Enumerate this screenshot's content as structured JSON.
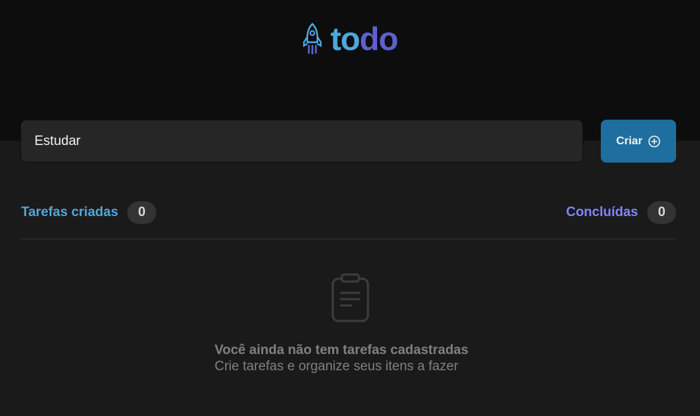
{
  "logo": {
    "part1": "to",
    "part2": "do"
  },
  "form": {
    "input_value": "Estudar",
    "create_label": "Criar"
  },
  "counters": {
    "created_label": "Tarefas criadas",
    "created_count": "0",
    "done_label": "Concluídas",
    "done_count": "0"
  },
  "empty_state": {
    "title": "Você ainda não tem tarefas cadastradas",
    "subtitle": "Crie tarefas e organize seus itens a fazer"
  },
  "icons": {
    "logo": "rocket-icon",
    "create": "plus-circle-icon",
    "empty": "clipboard-icon"
  },
  "colors": {
    "header_bg": "#0d0d0d",
    "body_bg": "#1a1a1a",
    "blue": "#4ea8de",
    "purple": "#8284fa",
    "purple_dark": "#5e60ce",
    "button": "#1e6f9f"
  }
}
